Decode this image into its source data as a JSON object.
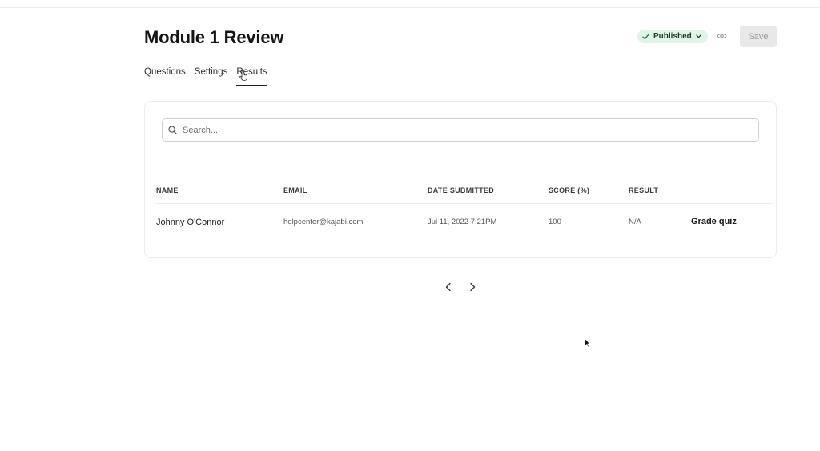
{
  "page": {
    "title": "Module 1 Review"
  },
  "tabs": [
    {
      "label": "Questions",
      "active": false
    },
    {
      "label": "Settings",
      "active": false
    },
    {
      "label": "Results",
      "active": true
    }
  ],
  "header": {
    "status_label": "Published",
    "status_color": "#dff3e7",
    "save_label": "Save",
    "preview_icon": "eye-icon"
  },
  "search": {
    "placeholder": "Search...",
    "value": ""
  },
  "table": {
    "columns": [
      "NAME",
      "EMAIL",
      "DATE SUBMITTED",
      "SCORE (%)",
      "RESULT"
    ],
    "rows": [
      {
        "name": "Johnny O'Connor",
        "email": "helpcenter@kajabi.com",
        "date_submitted": "Jul 11, 2022 7:21PM",
        "score": "100",
        "result": "N/A",
        "action_label": "Grade quiz"
      }
    ]
  },
  "pagination": {
    "prev_icon": "chevron-left-icon",
    "next_icon": "chevron-right-icon"
  }
}
